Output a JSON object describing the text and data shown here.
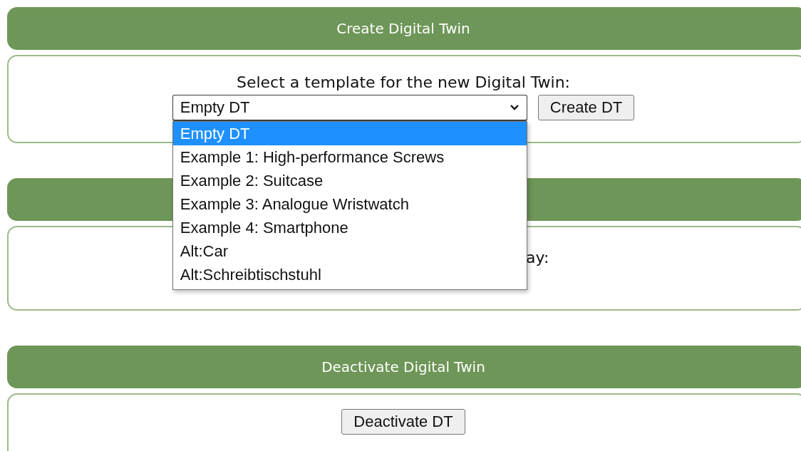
{
  "sections": [
    {
      "kind": "create",
      "header": "Create Digital Twin",
      "prompt": "Select a template for the new Digital Twin:",
      "select": {
        "value": "Empty DT",
        "expanded": true,
        "options": [
          {
            "label": "Empty DT",
            "selected": true
          },
          {
            "label": "Example 1: High-performance Screws",
            "selected": false
          },
          {
            "label": "Example 2: Suitcase",
            "selected": false
          },
          {
            "label": "Example 3: Analogue Wristwatch",
            "selected": false
          },
          {
            "label": "Example 4: Smartphone",
            "selected": false
          },
          {
            "label": "Alt:Car",
            "selected": false
          },
          {
            "label": "Alt:Schreibtischstuhl",
            "selected": false
          }
        ]
      },
      "button": "Create DT"
    },
    {
      "kind": "covered",
      "text": "ay:"
    },
    {
      "kind": "deactivate",
      "header": "Deactivate Digital Twin",
      "button": "Deactivate DT"
    }
  ]
}
